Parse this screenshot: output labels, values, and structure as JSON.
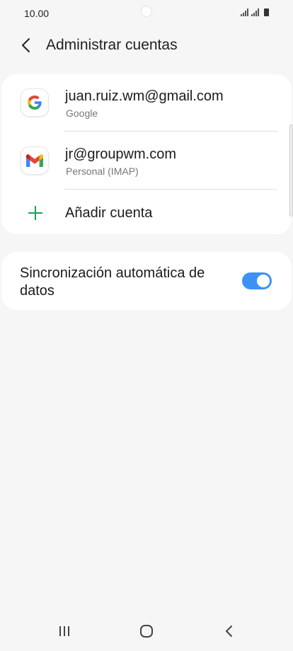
{
  "status_bar": {
    "time": "10.00",
    "icons": [
      "signal-icon",
      "signal-icon",
      "battery-icon"
    ]
  },
  "header": {
    "back_icon": "chevron-left-icon",
    "title": "Administrar cuentas"
  },
  "accounts": [
    {
      "email": "juan.ruiz.wm@gmail.com",
      "type": "Google",
      "icon": "google-icon"
    },
    {
      "email": "jr@groupwm.com",
      "type": "Personal (IMAP)",
      "icon": "gmail-icon"
    }
  ],
  "add_account": {
    "label": "Añadir cuenta",
    "icon": "plus-icon",
    "icon_color": "#1aa260"
  },
  "sync": {
    "label": "Sincronización automática de datos",
    "enabled": true,
    "toggle_color": "#3e91f7"
  },
  "nav_bar": {
    "recents_icon": "recents-icon",
    "home_icon": "home-icon",
    "back_icon": "back-icon"
  }
}
